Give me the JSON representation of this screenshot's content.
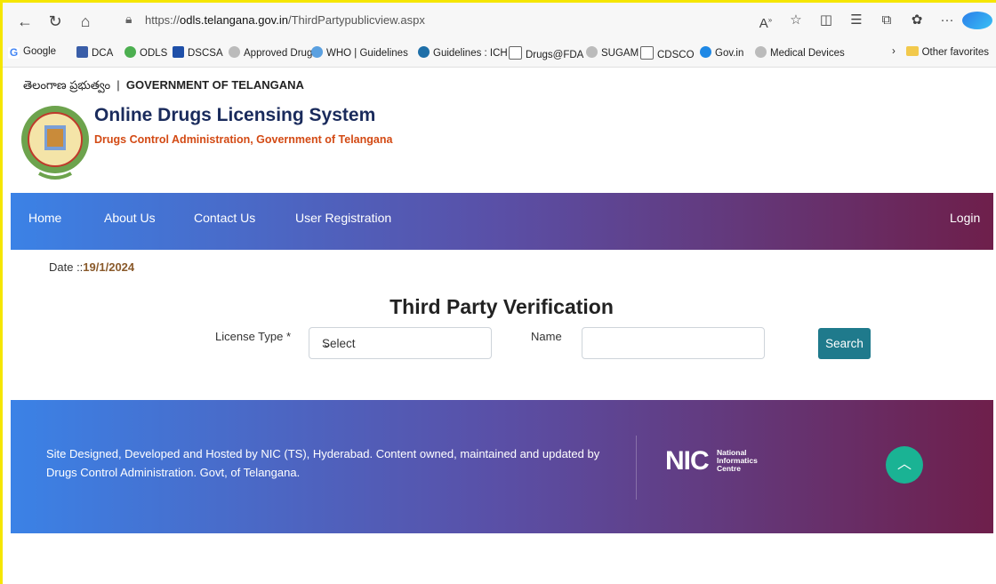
{
  "browser": {
    "url_prefix": "https://",
    "url_domain": "odls.telangana.gov.in",
    "url_path": "/ThirdPartypublicview.aspx",
    "more": "···"
  },
  "favorites": {
    "items": [
      {
        "label": "Google",
        "color": "#4285f4",
        "icon": "google-icon"
      },
      {
        "label": "DCA",
        "color": "#3a5ea8",
        "icon": "dca-icon"
      },
      {
        "label": "ODLS",
        "color": "#4caf50",
        "icon": "odls-icon"
      },
      {
        "label": "DSCSA",
        "color": "#1e4fa8",
        "icon": "fda-icon"
      },
      {
        "label": "Approved Drugs",
        "color": "#9e9e9e",
        "icon": "emblem-icon"
      },
      {
        "label": "WHO | Guidelines",
        "color": "#5aa0e0",
        "icon": "who-icon"
      },
      {
        "label": "Guidelines : ICH",
        "color": "#1e6fa8",
        "icon": "ich-icon"
      },
      {
        "label": "Drugs@FDA",
        "color": "#777777",
        "icon": "page-icon"
      },
      {
        "label": "SUGAM",
        "color": "#9e9e9e",
        "icon": "emblem-icon"
      },
      {
        "label": "CDSCO",
        "color": "#777777",
        "icon": "page-icon"
      },
      {
        "label": "Gov.in",
        "color": "#1e88e5",
        "icon": "gov-icon"
      },
      {
        "label": "Medical Devices",
        "color": "#9e9e9e",
        "icon": "emblem-icon"
      }
    ],
    "other": "Other favorites"
  },
  "header": {
    "telugu": "తెలంగాణ ప్రభుత్వం",
    "govt": "GOVERNMENT OF TELANGANA",
    "title": "Online Drugs Licensing System",
    "subtitle": "Drugs Control Administration, Government of Telangana"
  },
  "nav": {
    "home": "Home",
    "about": "About Us",
    "contact": "Contact Us",
    "register": "User Registration",
    "login": "Login"
  },
  "main": {
    "date_label": "Date ::",
    "date_value": "19/1/2024",
    "title": "Third Party Verification",
    "license_label": "License Type *",
    "license_selected": "Select",
    "name_label": "Name",
    "name_value": "",
    "search": "Search"
  },
  "footer": {
    "text": "Site Designed, Developed and Hosted by NIC (TS), Hyderabad. Content owned, maintained and updated by Drugs Control Administration. Govt, of Telangana.",
    "nic_big": "NIC",
    "nic_line1": "National",
    "nic_line2": "Informatics",
    "nic_line3": "Centre"
  },
  "colors": {
    "nav_gradient_start": "#3b82e6",
    "nav_gradient_end": "#6e1f4b",
    "search_button": "#1f7a8c",
    "scroll_top": "#1ab394"
  }
}
